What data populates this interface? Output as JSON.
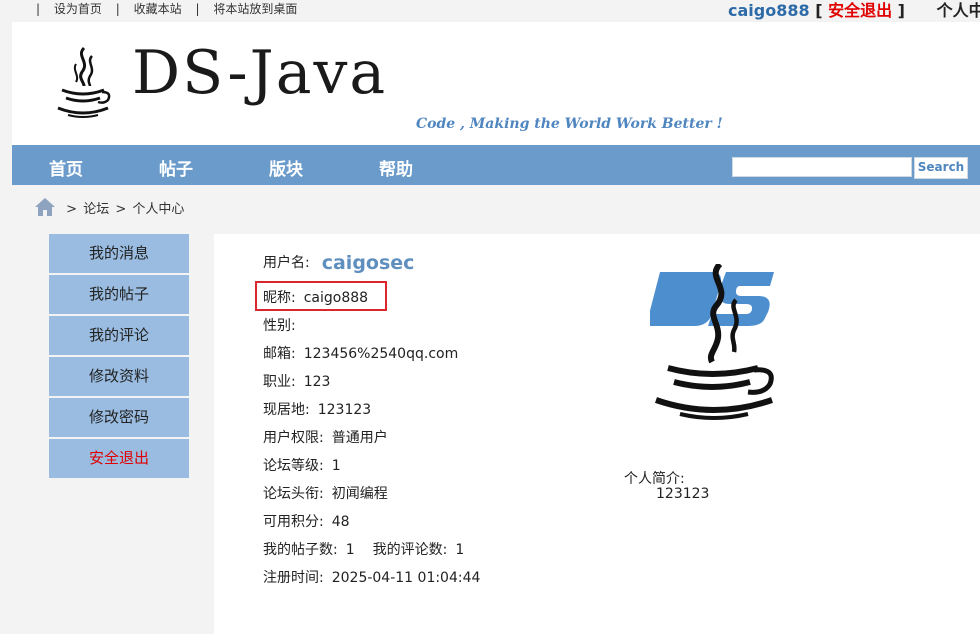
{
  "topbar": {
    "set_home": "设为首页",
    "bookmark": "收藏本站",
    "desktop": "将本站放到桌面",
    "username": "caigo888",
    "bracket_open": "[",
    "logout": "安全退出",
    "bracket_close": "]",
    "user_center": "个人中心"
  },
  "header": {
    "logo_text": "DS-Java",
    "slogan": "Code , Making the World Work Better !"
  },
  "nav": {
    "items": [
      "首页",
      "帖子",
      "版块",
      "帮助"
    ],
    "search_placeholder": "",
    "search_button": "Search"
  },
  "breadcrumb": {
    "parts": [
      "论坛",
      "个人中心"
    ],
    "separator": ">"
  },
  "sidebar": {
    "items": [
      "我的消息",
      "我的帖子",
      "我的评论",
      "修改资料",
      "修改密码",
      "安全退出"
    ]
  },
  "profile": {
    "username_label": "用户名:",
    "username": "caigosec",
    "nickname_label": "昵称:",
    "nickname": "caigo888",
    "gender_label": "性别:",
    "gender": "",
    "email_label": "邮箱:",
    "email": "123456%2540qq.com",
    "job_label": "职业:",
    "job": "123",
    "location_label": "现居地:",
    "location": "123123",
    "permission_label": "用户权限:",
    "permission": "普通用户",
    "level_label": "论坛等级:",
    "level": "1",
    "title_label": "论坛头衔:",
    "title": "初闻编程",
    "points_label": "可用积分:",
    "points": "48",
    "posts_label": "我的帖子数:",
    "posts": "1",
    "comments_label": "我的评论数:",
    "comments": "1",
    "register_label": "注册时间:",
    "register_time": "2025-04-11 01:04:44",
    "bio_label": "个人简介:",
    "bio": "123123"
  },
  "colors": {
    "nav_bg": "#6a9bcb",
    "sidebar_bg": "#99bce0",
    "accent_blue": "#4f86c0",
    "logout_red": "#e00000",
    "highlight_box": "#d9272e"
  }
}
